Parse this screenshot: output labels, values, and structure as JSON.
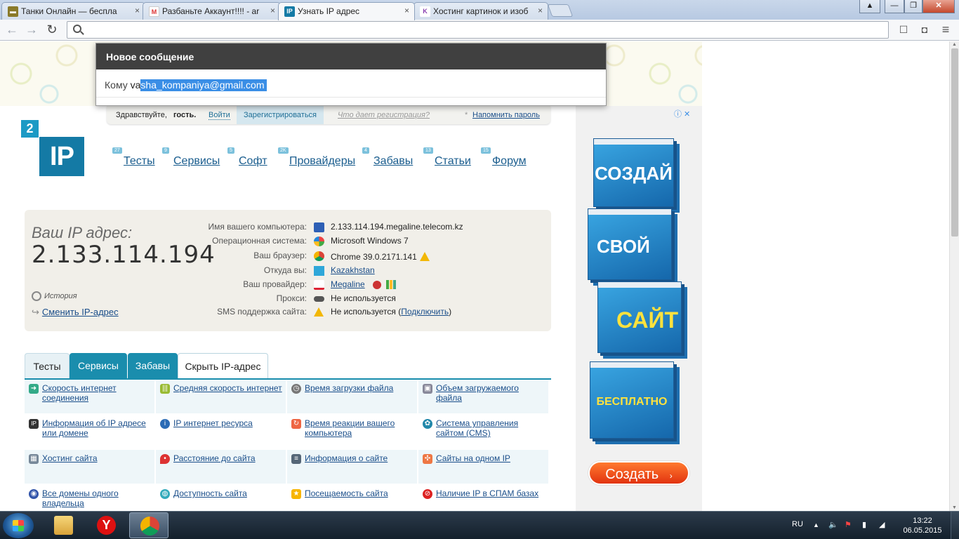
{
  "browser": {
    "tabs": [
      {
        "title": "Танки Онлайн — беспла",
        "favicon": "tank-favicon"
      },
      {
        "title": "Разбаньте Аккаунт!!!! - ar",
        "favicon": "gmail-favicon"
      },
      {
        "title": "Узнать IP адрес",
        "favicon": "2ip-favicon",
        "favicon_text": "IP",
        "active": true
      },
      {
        "title": "Хостинг картинок и изоб",
        "favicon": "k-favicon",
        "favicon_text": "K"
      }
    ],
    "tab_close": "×",
    "window_controls": {
      "menu": "▲",
      "minimize": "—",
      "maximize": "❐",
      "close": "✕"
    },
    "nav": {
      "back": "←",
      "forward": "→",
      "reload": "↻"
    },
    "omnibox_value": "",
    "toolbar_icons": {
      "bookmark": "☐",
      "extension": "◘",
      "menu": "≡"
    }
  },
  "compose": {
    "title": "Новое сообщение",
    "to_label": "Кому",
    "to_typed": "va",
    "to_selected": "sha_kompaniya@gmail.com"
  },
  "loginbar": {
    "greeting": "Здравствуйте,",
    "guest": "гость.",
    "login": "Войти",
    "register": "Зарегистрироваться",
    "benefits": "Что дает регистрация?",
    "remind": "Напомнить пароль"
  },
  "logo": {
    "two": "2",
    "ip": "IP"
  },
  "main_nav": [
    {
      "label": "Тесты",
      "badge": "27"
    },
    {
      "label": "Сервисы",
      "badge": "9"
    },
    {
      "label": "Софт",
      "badge": "5"
    },
    {
      "label": "Провайдеры",
      "badge": "2K"
    },
    {
      "label": "Забавы",
      "badge": "4"
    },
    {
      "label": "Статьи",
      "badge": "13"
    },
    {
      "label": "Форум",
      "badge": "15"
    }
  ],
  "ip_panel": {
    "label": "Ваш IP адрес:",
    "value": "2.133.114.194",
    "history": "История",
    "change": "Сменить IP-адрес",
    "rows": [
      {
        "key": "Имя вашего компьютера:",
        "value": "2.133.114.194.megaline.telecom.kz",
        "icon": "computer-icon",
        "link": false
      },
      {
        "key": "Операционная система:",
        "value": "Microsoft Windows 7",
        "icon": "windows-icon",
        "link": false
      },
      {
        "key": "Ваш браузер:",
        "value": "Chrome 39.0.2171.141",
        "icon": "chrome-icon",
        "link": false,
        "warn": true
      },
      {
        "key": "Откуда вы:",
        "value": "Kazakhstan",
        "icon": "kazakhstan-flag-icon",
        "link": true
      },
      {
        "key": "Ваш провайдер:",
        "value": "Megaline",
        "icon": "megaline-icon",
        "link": true
      },
      {
        "key": "Прокси:",
        "value": "Не используется",
        "icon": "glasses-icon",
        "link": false
      },
      {
        "key": "SMS поддержка сайта:",
        "value": "Не используется (",
        "value_link": "Подключить",
        "value_end": ")",
        "icon": "warning-icon",
        "link": false
      }
    ]
  },
  "section_tabs": [
    "Тесты",
    "Сервисы",
    "Забавы",
    "Скрыть IP-адрес"
  ],
  "services": [
    [
      "Скорость интернет соединения",
      "Средняя скорость интернет",
      "Время загрузки файла",
      "Объем загружаемого файла"
    ],
    [
      "Информация об IP адресе или домене",
      "IP интернет ресурса",
      "Время реакции вашего компьютера",
      "Система управления сайтом (CMS)"
    ],
    [
      "Хостинг сайта",
      "Расстояние до сайта",
      "Информация о сайте",
      "Сайты на одном IP"
    ],
    [
      "Все домены одного владельца",
      "Доступность сайта",
      "Посещаемость сайта",
      "Наличие IP в СПАМ базах"
    ]
  ],
  "ad": {
    "info": "ⓘ ✕",
    "words": [
      "СОЗДАЙ",
      "СВОЙ",
      "САЙТ",
      "БЕСПЛАТНО"
    ],
    "button": "Создать"
  },
  "taskbar": {
    "lang": "RU",
    "time": "13:22",
    "date": "06.05.2015"
  },
  "colors": {
    "accent": "#1a8dad",
    "link": "#1a4e8a",
    "ad_button": "#e2330f"
  }
}
